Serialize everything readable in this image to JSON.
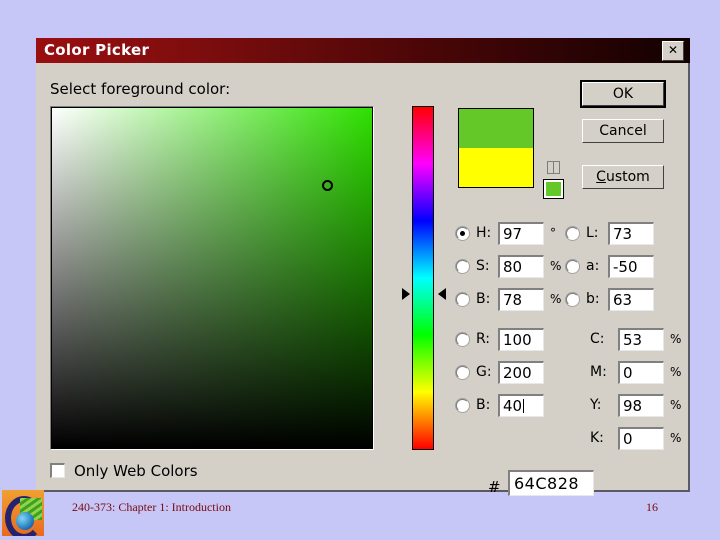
{
  "slide": {
    "footer_text": "240-373: Chapter 1: Introduction",
    "page_number": "16",
    "background_color": "#c6c6f7",
    "footer_color": "#7a0a10"
  },
  "dialog": {
    "title": "Color Picker",
    "close_label": "✕",
    "prompt": "Select foreground color:",
    "titlebar_color": "#7d0d0e",
    "face_color": "#d4d0c8"
  },
  "buttons": {
    "ok": "OK",
    "cancel": "Cancel",
    "custom_prefix": "C",
    "custom_rest": "ustom"
  },
  "preview": {
    "new_color": "#64C828",
    "current_color": "#FFFF00",
    "websafe_color": "#64C828",
    "cube_icon": "gamut-cube-icon"
  },
  "field": {
    "marker_x": "270",
    "marker_y": "72",
    "gradient_hue": "#2ee000"
  },
  "hue_slider": {
    "position": "250"
  },
  "checkbox": {
    "only_web_colors_label": "Only Web Colors",
    "checked": "false"
  },
  "hex": {
    "symbol": "#",
    "value": "64C828"
  },
  "color_values": {
    "hsb": [
      {
        "key": "H",
        "label": "H:",
        "value": "97",
        "unit": "°",
        "selected": "true"
      },
      {
        "key": "S",
        "label": "S:",
        "value": "80",
        "unit": "%",
        "selected": "false"
      },
      {
        "key": "B",
        "label": "B:",
        "value": "78",
        "unit": "%",
        "selected": "false"
      }
    ],
    "lab": [
      {
        "key": "L",
        "label": "L:",
        "value": "73",
        "unit": "",
        "selected": "false"
      },
      {
        "key": "a",
        "label": "a:",
        "value": "-50",
        "unit": "",
        "selected": "false"
      },
      {
        "key": "b",
        "label": "b:",
        "value": "63",
        "unit": "",
        "selected": "false"
      }
    ],
    "rgb": [
      {
        "key": "R",
        "label": "R:",
        "value": "100",
        "unit": "",
        "selected": "false"
      },
      {
        "key": "G",
        "label": "G:",
        "value": "200",
        "unit": "",
        "selected": "false"
      },
      {
        "key": "B",
        "label": "B:",
        "value": "40",
        "unit": "",
        "selected": "false",
        "caret": "true"
      }
    ],
    "cmyk": [
      {
        "key": "C",
        "label": "C:",
        "value": "53",
        "unit": "%"
      },
      {
        "key": "M",
        "label": "M:",
        "value": "0",
        "unit": "%"
      },
      {
        "key": "Y",
        "label": "Y:",
        "value": "98",
        "unit": "%"
      },
      {
        "key": "K",
        "label": "K:",
        "value": "0",
        "unit": "%"
      }
    ]
  }
}
